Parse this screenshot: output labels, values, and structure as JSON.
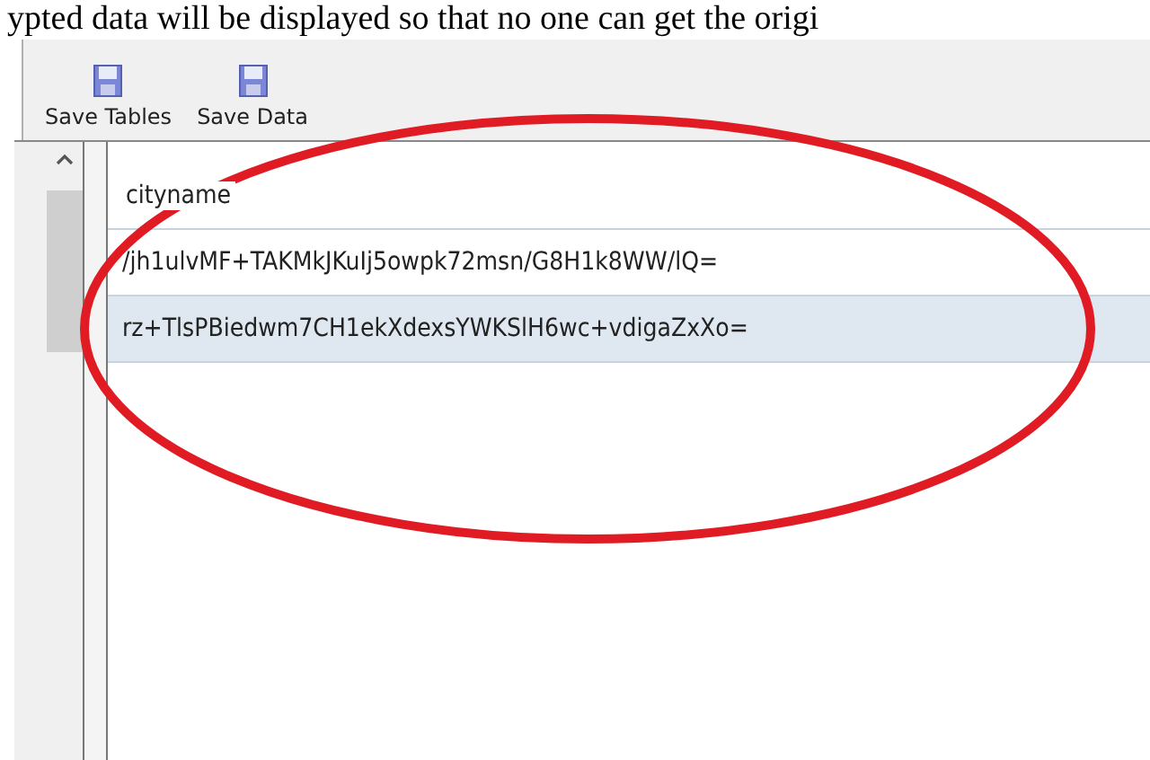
{
  "caption": "ypted data will be displayed so that no one can get the origi",
  "toolbar": {
    "buttons": [
      {
        "label": "Save Tables"
      },
      {
        "label": "Save Data"
      }
    ]
  },
  "table": {
    "columns": [
      "cityname"
    ],
    "rows": [
      {
        "cells": [
          "/jh1ulvMF+TAKMkJKuIj5owpk72msn/G8H1k8WW/lQ="
        ],
        "selected": false
      },
      {
        "cells": [
          "rz+TlsPBiedwm7CH1ekXdexsYWKSlH6wc+vdigaZxXo="
        ],
        "selected": true
      }
    ]
  },
  "annotation": {
    "kind": "ellipse",
    "color": "#e01b24"
  }
}
